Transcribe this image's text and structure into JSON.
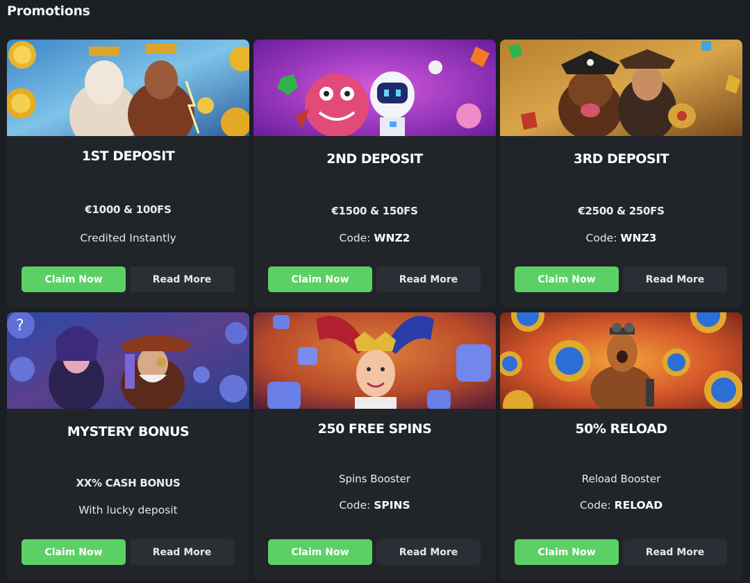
{
  "page": {
    "title": "Promotions"
  },
  "colors": {
    "claim_button": "#5bd165",
    "card_background": "#212429",
    "page_background": "#1b1e23"
  },
  "promotions": [
    {
      "title": "1ST DEPOSIT",
      "line1": "€1000 & 100FS",
      "line2_text": "Credited Instantly",
      "code_label": "",
      "code": "",
      "image": "zeus-gods-banner",
      "claim_label": "Claim Now",
      "read_label": "Read More"
    },
    {
      "title": "2ND DEPOSIT",
      "line1": "€1500 & 150FS",
      "line2_text": "",
      "code_label": "Code:",
      "code": "WNZ2",
      "image": "candy-monster-astronaut-banner",
      "claim_label": "Claim Now",
      "read_label": "Read More"
    },
    {
      "title": "3RD DEPOSIT",
      "line1": "€2500 & 250FS",
      "line2_text": "",
      "code_label": "Code:",
      "code": "WNZ3",
      "image": "pirate-dog-adventurer-banner",
      "claim_label": "Claim Now",
      "read_label": "Read More"
    },
    {
      "title": "MYSTERY BONUS",
      "line1": "XX% CASH BONUS",
      "line2_text": "With lucky deposit",
      "code_label": "",
      "code": "",
      "image": "mystery-characters-banner",
      "claim_label": "Claim Now",
      "read_label": "Read More"
    },
    {
      "title": "250 FREE SPINS",
      "line1": "Spins Booster",
      "line2_text": "",
      "code_label": "Code:",
      "code": "SPINS",
      "image": "jester-spins-banner",
      "claim_label": "Claim Now",
      "read_label": "Read More"
    },
    {
      "title": "50% RELOAD",
      "line1": "Reload Booster",
      "line2_text": "",
      "code_label": "Code:",
      "code": "RELOAD",
      "image": "lightning-warrior-banner",
      "claim_label": "Claim Now",
      "read_label": "Read More"
    }
  ]
}
